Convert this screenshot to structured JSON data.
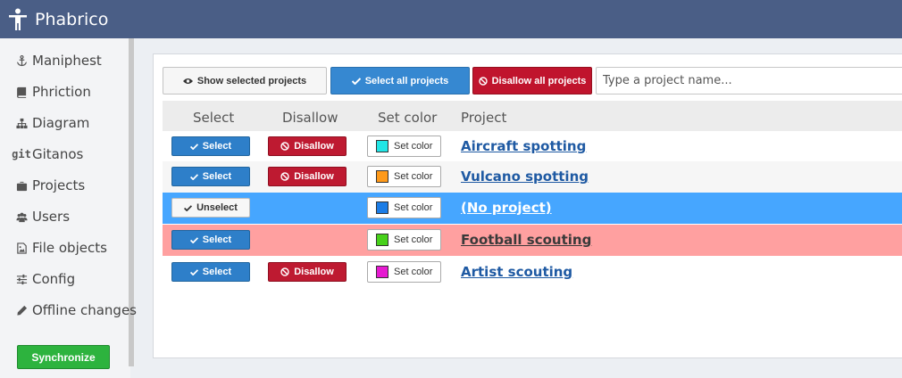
{
  "app": {
    "title": "Phabrico"
  },
  "sidebar": {
    "items": [
      {
        "label": "Maniphest",
        "icon": "anchor-icon"
      },
      {
        "label": "Phriction",
        "icon": "book-icon"
      },
      {
        "label": "Diagram",
        "icon": "sitemap-icon"
      },
      {
        "label": "Gitanos",
        "icon": "git-icon",
        "icon_text": "git"
      },
      {
        "label": "Projects",
        "icon": "briefcase-icon"
      },
      {
        "label": "Users",
        "icon": "users-icon"
      },
      {
        "label": "File objects",
        "icon": "image-file-icon"
      },
      {
        "label": "Config",
        "icon": "sliders-icon"
      },
      {
        "label": "Offline changes",
        "icon": "pencil-icon"
      }
    ],
    "sync_label": "Synchronize"
  },
  "toolbar": {
    "show_selected_label": "Show selected projects",
    "select_all_label": "Select all projects",
    "disallow_all_label": "Disallow all projects",
    "search_placeholder": "Type a project name..."
  },
  "table": {
    "headers": [
      "Select",
      "Disallow",
      "Set color",
      "Project"
    ],
    "rows": [
      {
        "select_label": "Select",
        "selected": false,
        "disallow_label": "Disallow",
        "show_disallow": true,
        "color_label": "Set color",
        "color": "#22e6e6",
        "project": "Aircraft spotting",
        "row_bg": "#ffffff",
        "link_color": "#1f5aa3"
      },
      {
        "select_label": "Select",
        "selected": false,
        "disallow_label": "Disallow",
        "show_disallow": true,
        "color_label": "Set color",
        "color": "#ff9a1a",
        "project": "Vulcano spotting",
        "row_bg": "#f6f6f6",
        "link_color": "#1f5aa3"
      },
      {
        "select_label": "Unselect",
        "selected": true,
        "disallow_label": "",
        "show_disallow": false,
        "color_label": "Set color",
        "color": "#1c7de6",
        "project": "(No project)",
        "row_bg": "#46a6ff",
        "link_color": "#ffffff"
      },
      {
        "select_label": "Select",
        "selected": false,
        "disallow_label": "",
        "show_disallow": false,
        "color_label": "Set color",
        "color": "#47d11a",
        "project": "Football scouting",
        "row_bg": "#ffa0a0",
        "link_color": "#3a3a3a"
      },
      {
        "select_label": "Select",
        "selected": false,
        "disallow_label": "Disallow",
        "show_disallow": true,
        "color_label": "Set color",
        "color": "#e61ad1",
        "project": "Artist scouting",
        "row_bg": "#ffffff",
        "link_color": "#1f5aa3"
      }
    ]
  },
  "colors": {
    "topbar": "#4a5e86",
    "primary": "#2e7fc9",
    "danger": "#be1a31",
    "success": "#2db33e"
  }
}
